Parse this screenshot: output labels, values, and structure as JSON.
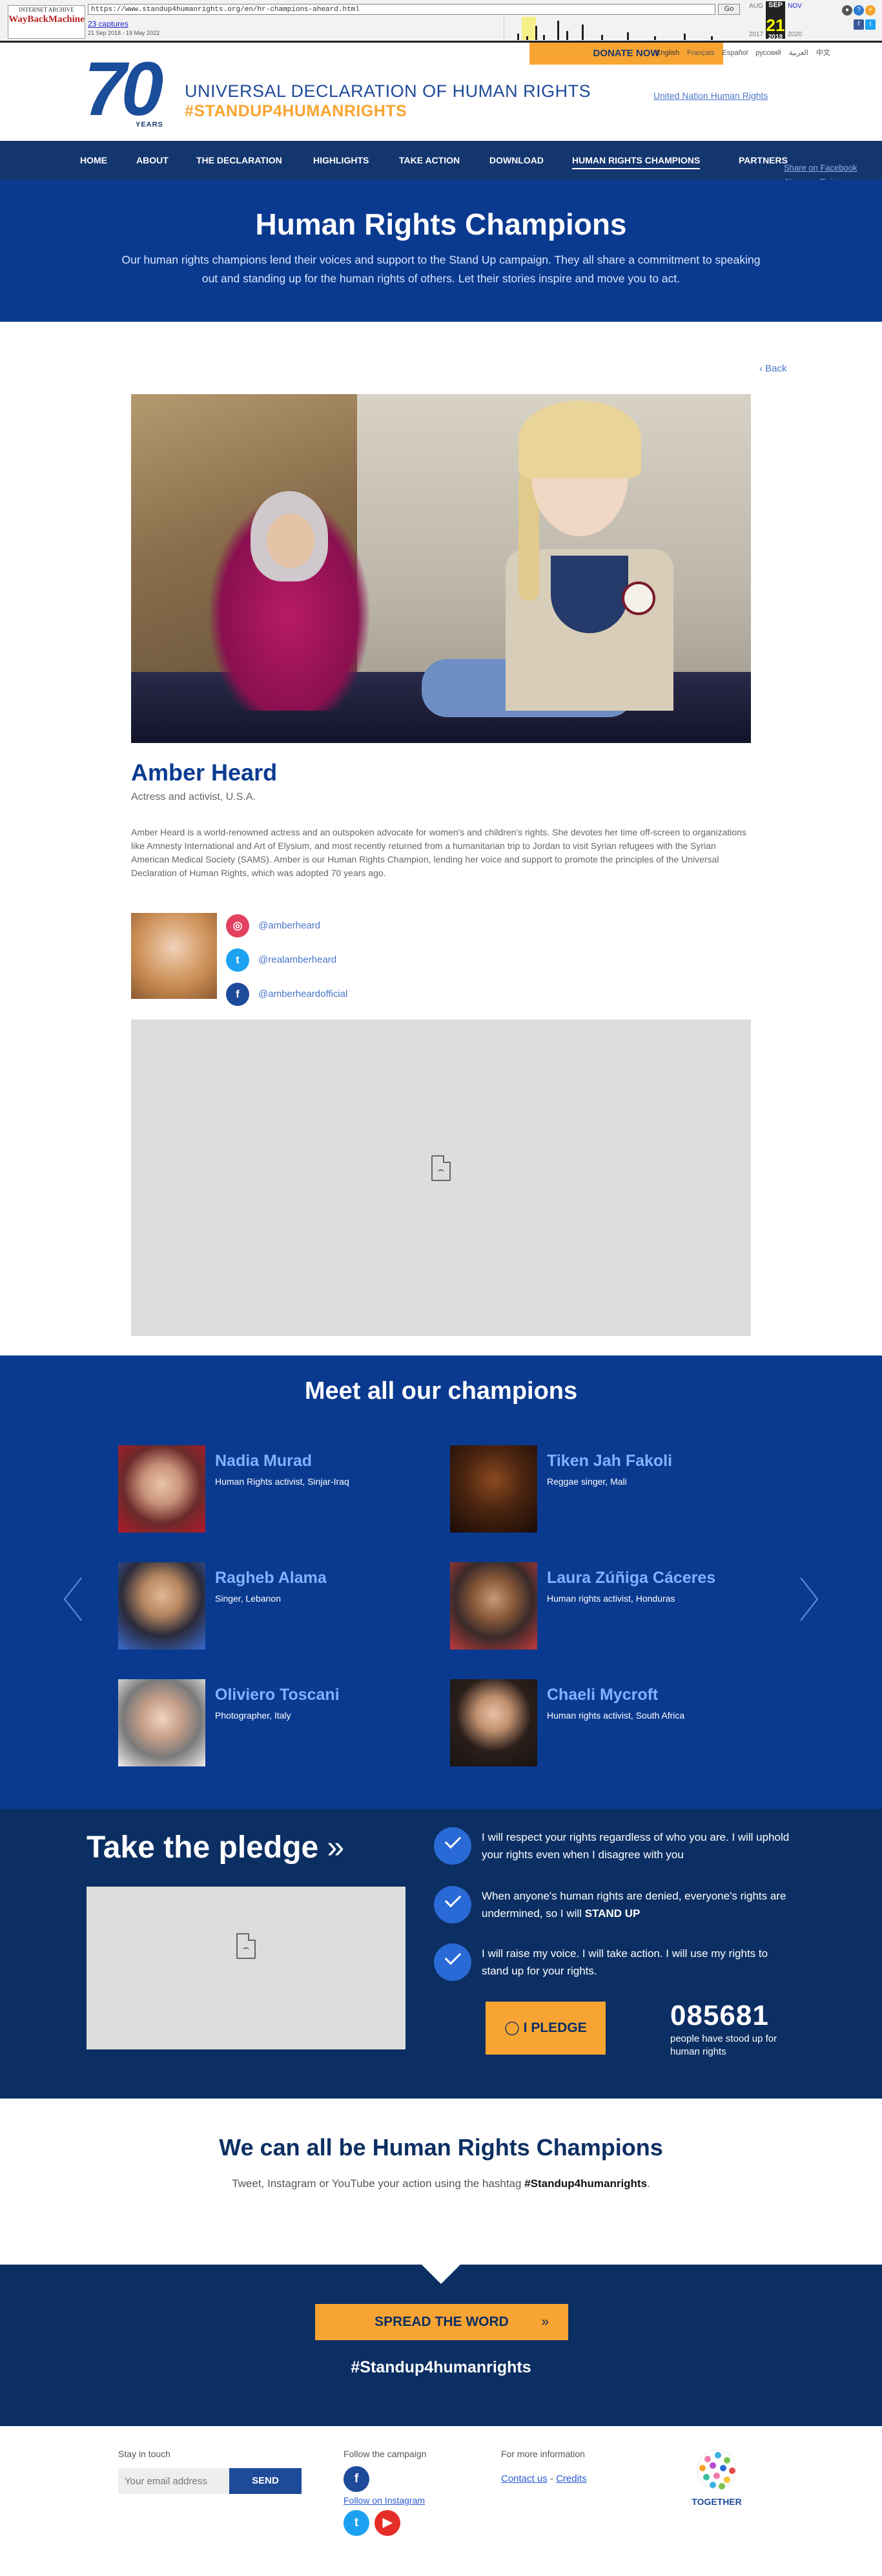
{
  "wayback": {
    "url": "https://www.standup4humanrights.org/en/hr-champions-aheard.html",
    "go": "Go",
    "captures": "23 captures",
    "range": "21 Sep 2018 - 19 May 2022",
    "months": [
      "AUG",
      "SEP",
      "NOV"
    ],
    "day": "21",
    "years": [
      "2017",
      "2018",
      "2020"
    ],
    "logo_top": "INTERNET ARCHIVE",
    "logo_main": "WayBackMachine"
  },
  "header": {
    "donate": "DONATE NOW",
    "logo_number": "70",
    "logo_years": "YEARS",
    "title": "UNIVERSAL DECLARATION OF HUMAN RIGHTS",
    "hashtag": "#STANDUP4HUMANRIGHTS",
    "languages": [
      "English",
      "Français",
      "Español",
      "русский",
      "العربية",
      "中文"
    ],
    "un_logo_alt": "United Nation Human Rights"
  },
  "nav": {
    "items": [
      "HOME",
      "ABOUT",
      "THE DECLARATION",
      "HIGHLIGHTS",
      "TAKE ACTION",
      "DOWNLOAD",
      "HUMAN RIGHTS CHAMPIONS",
      "PARTNERS"
    ],
    "share_facebook": "Share on Facebook",
    "share_twitter": "Share on Twitter"
  },
  "hero": {
    "title": "Human Rights Champions",
    "text": "Our human rights champions lend their voices and support to the Stand Up campaign. They all share a commitment to speaking out and standing up for the human rights of others. Let their stories inspire and move you to act."
  },
  "back": "‹ Back",
  "champion": {
    "name": "Amber Heard",
    "role": "Actress and activist, U.S.A.",
    "bio": "Amber Heard is a world-renowned actress and an outspoken advocate for women's and children's rights. She devotes her time off-screen to organizations like Amnesty International and Art of Elysium, and most recently returned from a humanitarian trip to Jordan to visit Syrian refugees with the Syrian American Medical Society (SAMS). Amber is our Human Rights Champion, lending her voice and support to promote the principles of the Universal Declaration of Human Rights, which was adopted 70 years ago.",
    "socials": [
      {
        "network": "instagram",
        "handle": "@amberheard",
        "color": "#e4405f"
      },
      {
        "network": "twitter",
        "handle": "@realamberheard",
        "color": "#1da1f2"
      },
      {
        "network": "facebook",
        "handle": "@amberheardofficial",
        "color": "#1e4a9a"
      }
    ]
  },
  "champions": {
    "title": "Meet all our champions",
    "list": [
      {
        "name": "Nadia Murad",
        "role": "Human Rights activist, Sinjar-Iraq"
      },
      {
        "name": "Tiken Jah Fakoli",
        "role": "Reggae singer, Mali"
      },
      {
        "name": "Ragheb Alama",
        "role": "Singer, Lebanon"
      },
      {
        "name": "Laura Zúñiga Cáceres",
        "role": "Human rights activist, Honduras"
      },
      {
        "name": "Oliviero Toscani",
        "role": "Photographer, Italy"
      },
      {
        "name": "Chaeli Mycroft",
        "role": "Human rights activist, South Africa"
      }
    ]
  },
  "pledge": {
    "title": "Take the pledge",
    "promises": [
      {
        "text": "I will respect your rights regardless of who you are. I will uphold your rights even when I disagree with you",
        "strong": ""
      },
      {
        "text": "When anyone's human rights are denied, everyone's rights are undermined, so I will ",
        "strong": "STAND UP"
      },
      {
        "text": "I will raise my voice. I will take action. I will use my rights to stand up for your rights.",
        "strong": ""
      }
    ],
    "button": "I PLEDGE",
    "count": "085681",
    "count_label": "people have stood up for human rights"
  },
  "wecan": {
    "title": "We can all be Human Rights Champions",
    "text": "Tweet, Instagram or YouTube your action using the hashtag ",
    "hashtag": "#Standup4humanrights",
    "end": "."
  },
  "spread": {
    "button": "SPREAD THE WORD",
    "hashtag": "#Standup4humanrights"
  },
  "footer": {
    "stay": "Stay in touch",
    "email_placeholder": "Your email address",
    "send": "SEND",
    "follow": "Follow the campaign",
    "instagram_alt": "Follow on Instagram",
    "more": "For more information",
    "contact": "Contact us",
    "sep": " - ",
    "credits": "Credits",
    "together": "TOGETHER"
  }
}
